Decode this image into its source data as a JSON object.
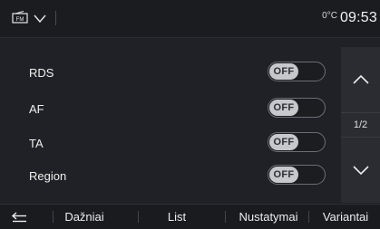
{
  "header": {
    "source_icon": "fm-radio-icon",
    "source_icon_text": "FM",
    "menu_icon": "chevron-down-icon",
    "temperature": "0°C",
    "time": "09:53"
  },
  "settings": {
    "rows": [
      {
        "label": "RDS",
        "state": "OFF"
      },
      {
        "label": "AF",
        "state": "OFF"
      },
      {
        "label": "TA",
        "state": "OFF"
      },
      {
        "label": "Region",
        "state": "OFF"
      }
    ]
  },
  "scroll": {
    "up_icon": "chevron-up-icon",
    "down_icon": "chevron-down-icon",
    "page": "1/2"
  },
  "bottom": {
    "back_icon": "back-arrow-icon",
    "tabs": [
      "Dažniai",
      "List",
      "Nustatymai",
      "Variantai"
    ]
  },
  "colors": {
    "background": "#202126",
    "toggle_knob": "#c7c8cc",
    "text": "#f0f0f0"
  }
}
